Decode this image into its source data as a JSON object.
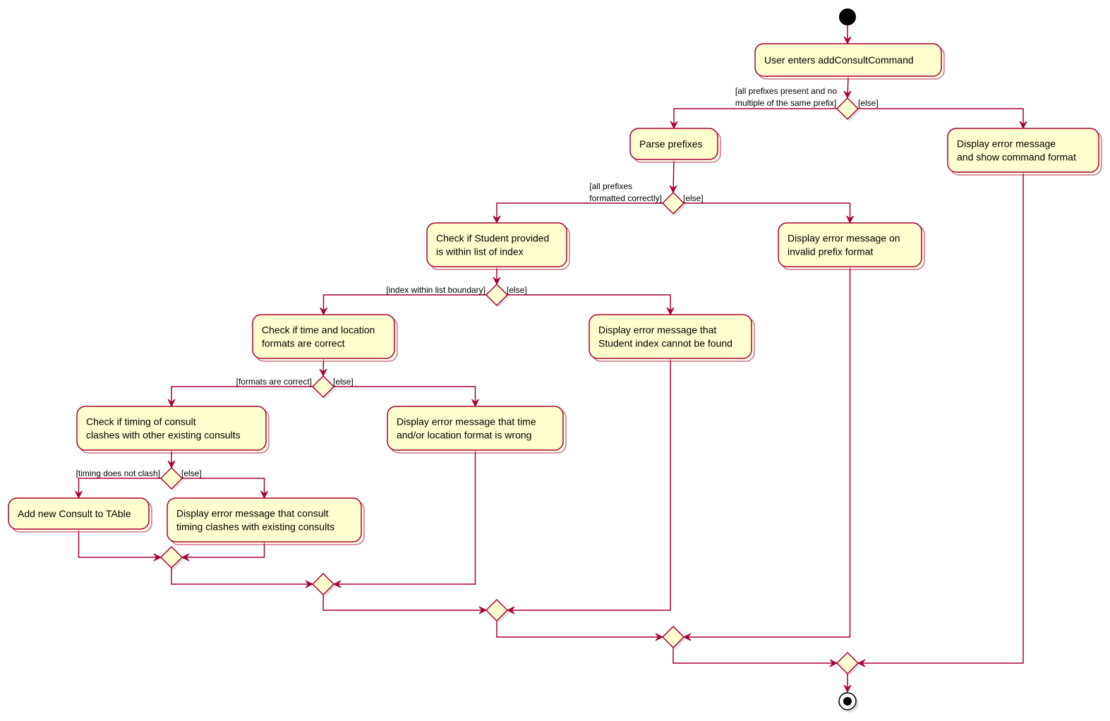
{
  "diagram": {
    "type": "activity",
    "colors": {
      "node_fill": "#FEFECE",
      "stroke": "#A80036",
      "text": "#000000",
      "start": "#000000"
    },
    "start": {
      "id": "start"
    },
    "end": {
      "id": "end"
    },
    "actions": [
      {
        "id": "a_enter",
        "lines": [
          "User enters addConsultCommand"
        ]
      },
      {
        "id": "a_parse",
        "lines": [
          "Parse prefixes"
        ]
      },
      {
        "id": "a_err_format",
        "lines": [
          "Display error message",
          "and show command format"
        ]
      },
      {
        "id": "a_check_student",
        "lines": [
          "Check if Student provided",
          "is within list of index"
        ]
      },
      {
        "id": "a_err_prefix",
        "lines": [
          "Display error message on",
          "invalid prefix format"
        ]
      },
      {
        "id": "a_check_time",
        "lines": [
          "Check if time and location",
          "formats are correct"
        ]
      },
      {
        "id": "a_err_student",
        "lines": [
          "Display error message that",
          "Student index cannot be found"
        ]
      },
      {
        "id": "a_check_clash",
        "lines": [
          "Check if timing of consult",
          "clashes with other existing consults"
        ]
      },
      {
        "id": "a_err_time",
        "lines": [
          " Display error message that time",
          "and/or location format is wrong"
        ]
      },
      {
        "id": "a_add",
        "lines": [
          "Add new Consult to TAble"
        ]
      },
      {
        "id": "a_err_clash",
        "lines": [
          "Display error message that consult",
          "timing clashes with existing consults"
        ]
      }
    ],
    "decisions": [
      {
        "id": "d1",
        "yes_guard": [
          "[all prefixes present and no",
          "multiple of the same prefix]"
        ],
        "else_guard": "[else]"
      },
      {
        "id": "d2",
        "yes_guard": [
          "[all prefixes",
          "    formatted correctly]"
        ],
        "else_guard": "[else]"
      },
      {
        "id": "d3",
        "yes_guard": [
          "[index within list boundary]"
        ],
        "else_guard": "[else]"
      },
      {
        "id": "d4",
        "yes_guard": [
          "[formats are correct]"
        ],
        "else_guard": "[else]"
      },
      {
        "id": "d5",
        "yes_guard": [
          "[timing does not clash]"
        ],
        "else_guard": "[else]"
      }
    ],
    "merges": [
      {
        "id": "m5"
      },
      {
        "id": "m4"
      },
      {
        "id": "m3"
      },
      {
        "id": "m2"
      },
      {
        "id": "m1"
      }
    ],
    "flows": [
      [
        "start",
        "a_enter"
      ],
      [
        "a_enter",
        "d1"
      ],
      [
        "d1",
        "a_parse"
      ],
      [
        "d1",
        "a_err_format"
      ],
      [
        "a_parse",
        "d2"
      ],
      [
        "d2",
        "a_check_student"
      ],
      [
        "d2",
        "a_err_prefix"
      ],
      [
        "a_check_student",
        "d3"
      ],
      [
        "d3",
        "a_check_time"
      ],
      [
        "d3",
        "a_err_student"
      ],
      [
        "a_check_time",
        "d4"
      ],
      [
        "d4",
        "a_check_clash"
      ],
      [
        "d4",
        "a_err_time"
      ],
      [
        "a_check_clash",
        "d5"
      ],
      [
        "d5",
        "a_add"
      ],
      [
        "d5",
        "a_err_clash"
      ],
      [
        "a_add",
        "m5"
      ],
      [
        "a_err_clash",
        "m5"
      ],
      [
        "m5",
        "m4"
      ],
      [
        "a_err_time",
        "m4"
      ],
      [
        "m4",
        "m3"
      ],
      [
        "a_err_student",
        "m3"
      ],
      [
        "m3",
        "m2"
      ],
      [
        "a_err_prefix",
        "m2"
      ],
      [
        "m2",
        "m1"
      ],
      [
        "a_err_format",
        "m1"
      ],
      [
        "m1",
        "end"
      ]
    ]
  }
}
